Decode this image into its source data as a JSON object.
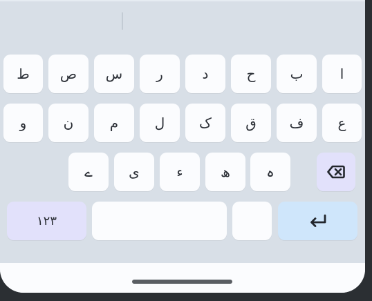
{
  "keyboard": {
    "row1": [
      "ط",
      "ص",
      "س",
      "ر",
      "د",
      "ح",
      "ب",
      "ا"
    ],
    "row2": [
      "و",
      "ن",
      "م",
      "ل",
      "ک",
      "ق",
      "ف",
      "ع"
    ],
    "row3": [
      "ے",
      "ی",
      "ء",
      "ھ",
      "ہ"
    ],
    "numbers_label": "١٢٣",
    "backspace_icon": "backspace-icon",
    "enter_icon": "enter-icon"
  }
}
